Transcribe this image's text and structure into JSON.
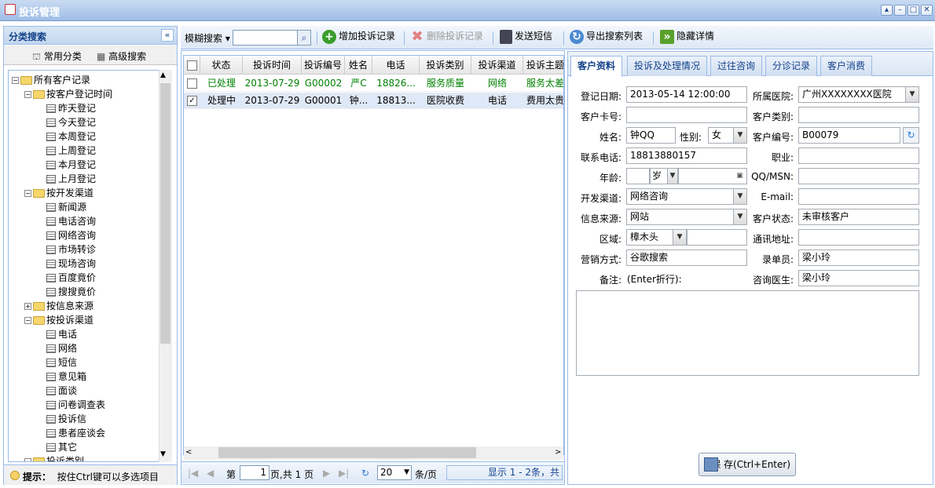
{
  "window": {
    "title": "投诉管理"
  },
  "left_panel": {
    "title": "分类搜索",
    "tab_common": "常用分类",
    "tab_advanced": "高级搜索",
    "tree": [
      {
        "label": "所有客户记录",
        "level": 0,
        "kind": "folder",
        "exp": "−"
      },
      {
        "label": "按客户登记时间",
        "level": 1,
        "kind": "folder",
        "exp": "−"
      },
      {
        "label": "昨天登记",
        "level": 2,
        "kind": "leaf"
      },
      {
        "label": "今天登记",
        "level": 2,
        "kind": "leaf"
      },
      {
        "label": "本周登记",
        "level": 2,
        "kind": "leaf"
      },
      {
        "label": "上周登记",
        "level": 2,
        "kind": "leaf"
      },
      {
        "label": "本月登记",
        "level": 2,
        "kind": "leaf"
      },
      {
        "label": "上月登记",
        "level": 2,
        "kind": "leaf"
      },
      {
        "label": "按开发渠道",
        "level": 1,
        "kind": "folder",
        "exp": "−"
      },
      {
        "label": "新闻源",
        "level": 2,
        "kind": "leaf"
      },
      {
        "label": "电话咨询",
        "level": 2,
        "kind": "leaf"
      },
      {
        "label": "网络咨询",
        "level": 2,
        "kind": "leaf"
      },
      {
        "label": "市场转诊",
        "level": 2,
        "kind": "leaf"
      },
      {
        "label": "现场咨询",
        "level": 2,
        "kind": "leaf"
      },
      {
        "label": "百度竟价",
        "level": 2,
        "kind": "leaf"
      },
      {
        "label": "搜搜竟价",
        "level": 2,
        "kind": "leaf"
      },
      {
        "label": "按信息来源",
        "level": 1,
        "kind": "folder",
        "exp": "+"
      },
      {
        "label": "按投诉渠道",
        "level": 1,
        "kind": "folder",
        "exp": "−"
      },
      {
        "label": "电话",
        "level": 2,
        "kind": "leaf"
      },
      {
        "label": "网络",
        "level": 2,
        "kind": "leaf"
      },
      {
        "label": "短信",
        "level": 2,
        "kind": "leaf"
      },
      {
        "label": "意见箱",
        "level": 2,
        "kind": "leaf"
      },
      {
        "label": "面谈",
        "level": 2,
        "kind": "leaf"
      },
      {
        "label": "问卷调查表",
        "level": 2,
        "kind": "leaf"
      },
      {
        "label": "投诉信",
        "level": 2,
        "kind": "leaf"
      },
      {
        "label": "患者座谈会",
        "level": 2,
        "kind": "leaf"
      },
      {
        "label": "其它",
        "level": 2,
        "kind": "leaf"
      },
      {
        "label": "投诉类别",
        "level": 1,
        "kind": "folder",
        "exp": "−"
      }
    ],
    "tip_label": "提示：",
    "tip_text": "按住Ctrl键可以多选项目"
  },
  "toolbar": {
    "fuzzy_search": "模糊搜索",
    "add": "增加投诉记录",
    "delete": "删除投诉记录",
    "sms": "发送短信",
    "export": "导出搜索列表",
    "hide": "隐藏详情"
  },
  "grid": {
    "columns": [
      "状态",
      "投诉时间",
      "投诉编号",
      "姓名",
      "电话",
      "投诉类别",
      "投诉渠道",
      "投诉主题"
    ],
    "rows": [
      {
        "checked": false,
        "status": "已处理",
        "time": "2013-07-29",
        "no": "G00002",
        "name": "严C",
        "phone": "18826...",
        "category": "服务质量",
        "channel": "网络",
        "subject": "服务太差",
        "color": "#008000"
      },
      {
        "checked": true,
        "status": "处理中",
        "time": "2013-07-29",
        "no": "G00001",
        "name": "钟...",
        "phone": "18813...",
        "category": "医院收费",
        "channel": "电话",
        "subject": "费用太贵",
        "color": "#000000"
      }
    ]
  },
  "pager": {
    "page_prefix": "第",
    "page": "1",
    "page_suffix": "页,共 1 页",
    "page_size": "20",
    "per_page": "条/页",
    "display": "显示 1 - 2条，共"
  },
  "tabs": [
    "客户资料",
    "投诉及处理情况",
    "过往咨询",
    "分诊记录",
    "客户消费"
  ],
  "form": {
    "reg_date_label": "登记日期:",
    "reg_date": "2013-05-14 12:00:00",
    "hospital_label": "所属医院:",
    "hospital": "广州XXXXXXXX医院",
    "card_label": "客户卡号:",
    "card": "",
    "type_label": "客户类别:",
    "type": "",
    "name_label": "姓名:",
    "name": "钟QQ",
    "gender_label": "性别:",
    "gender": "女",
    "no_label": "客户编号:",
    "no": "B00079",
    "phone_label": "联系电话:",
    "phone": "18813880157",
    "job_label": "职业:",
    "job": "",
    "age_label": "年龄:",
    "age_unit": "岁",
    "qq_label": "QQ/MSN:",
    "qq": "",
    "channel_label": "开发渠道:",
    "channel": "网络咨询",
    "email_label": "E-mail:",
    "email": "",
    "source_label": "信息来源:",
    "source": "网站",
    "status_label": "客户状态:",
    "status": "未审核客户",
    "area_label": "区域:",
    "area": "樟木头",
    "address_label": "通讯地址:",
    "address": "",
    "marketing_label": "营销方式:",
    "marketing": "谷歌搜索",
    "recorder_label": "录单员:",
    "recorder": "梁小玲",
    "remark_label": "备注:",
    "remark_hint": "(Enter折行):",
    "doctor_label": "咨询医生:",
    "doctor": "梁小玲",
    "save": "保 存(Ctrl+Enter)"
  }
}
